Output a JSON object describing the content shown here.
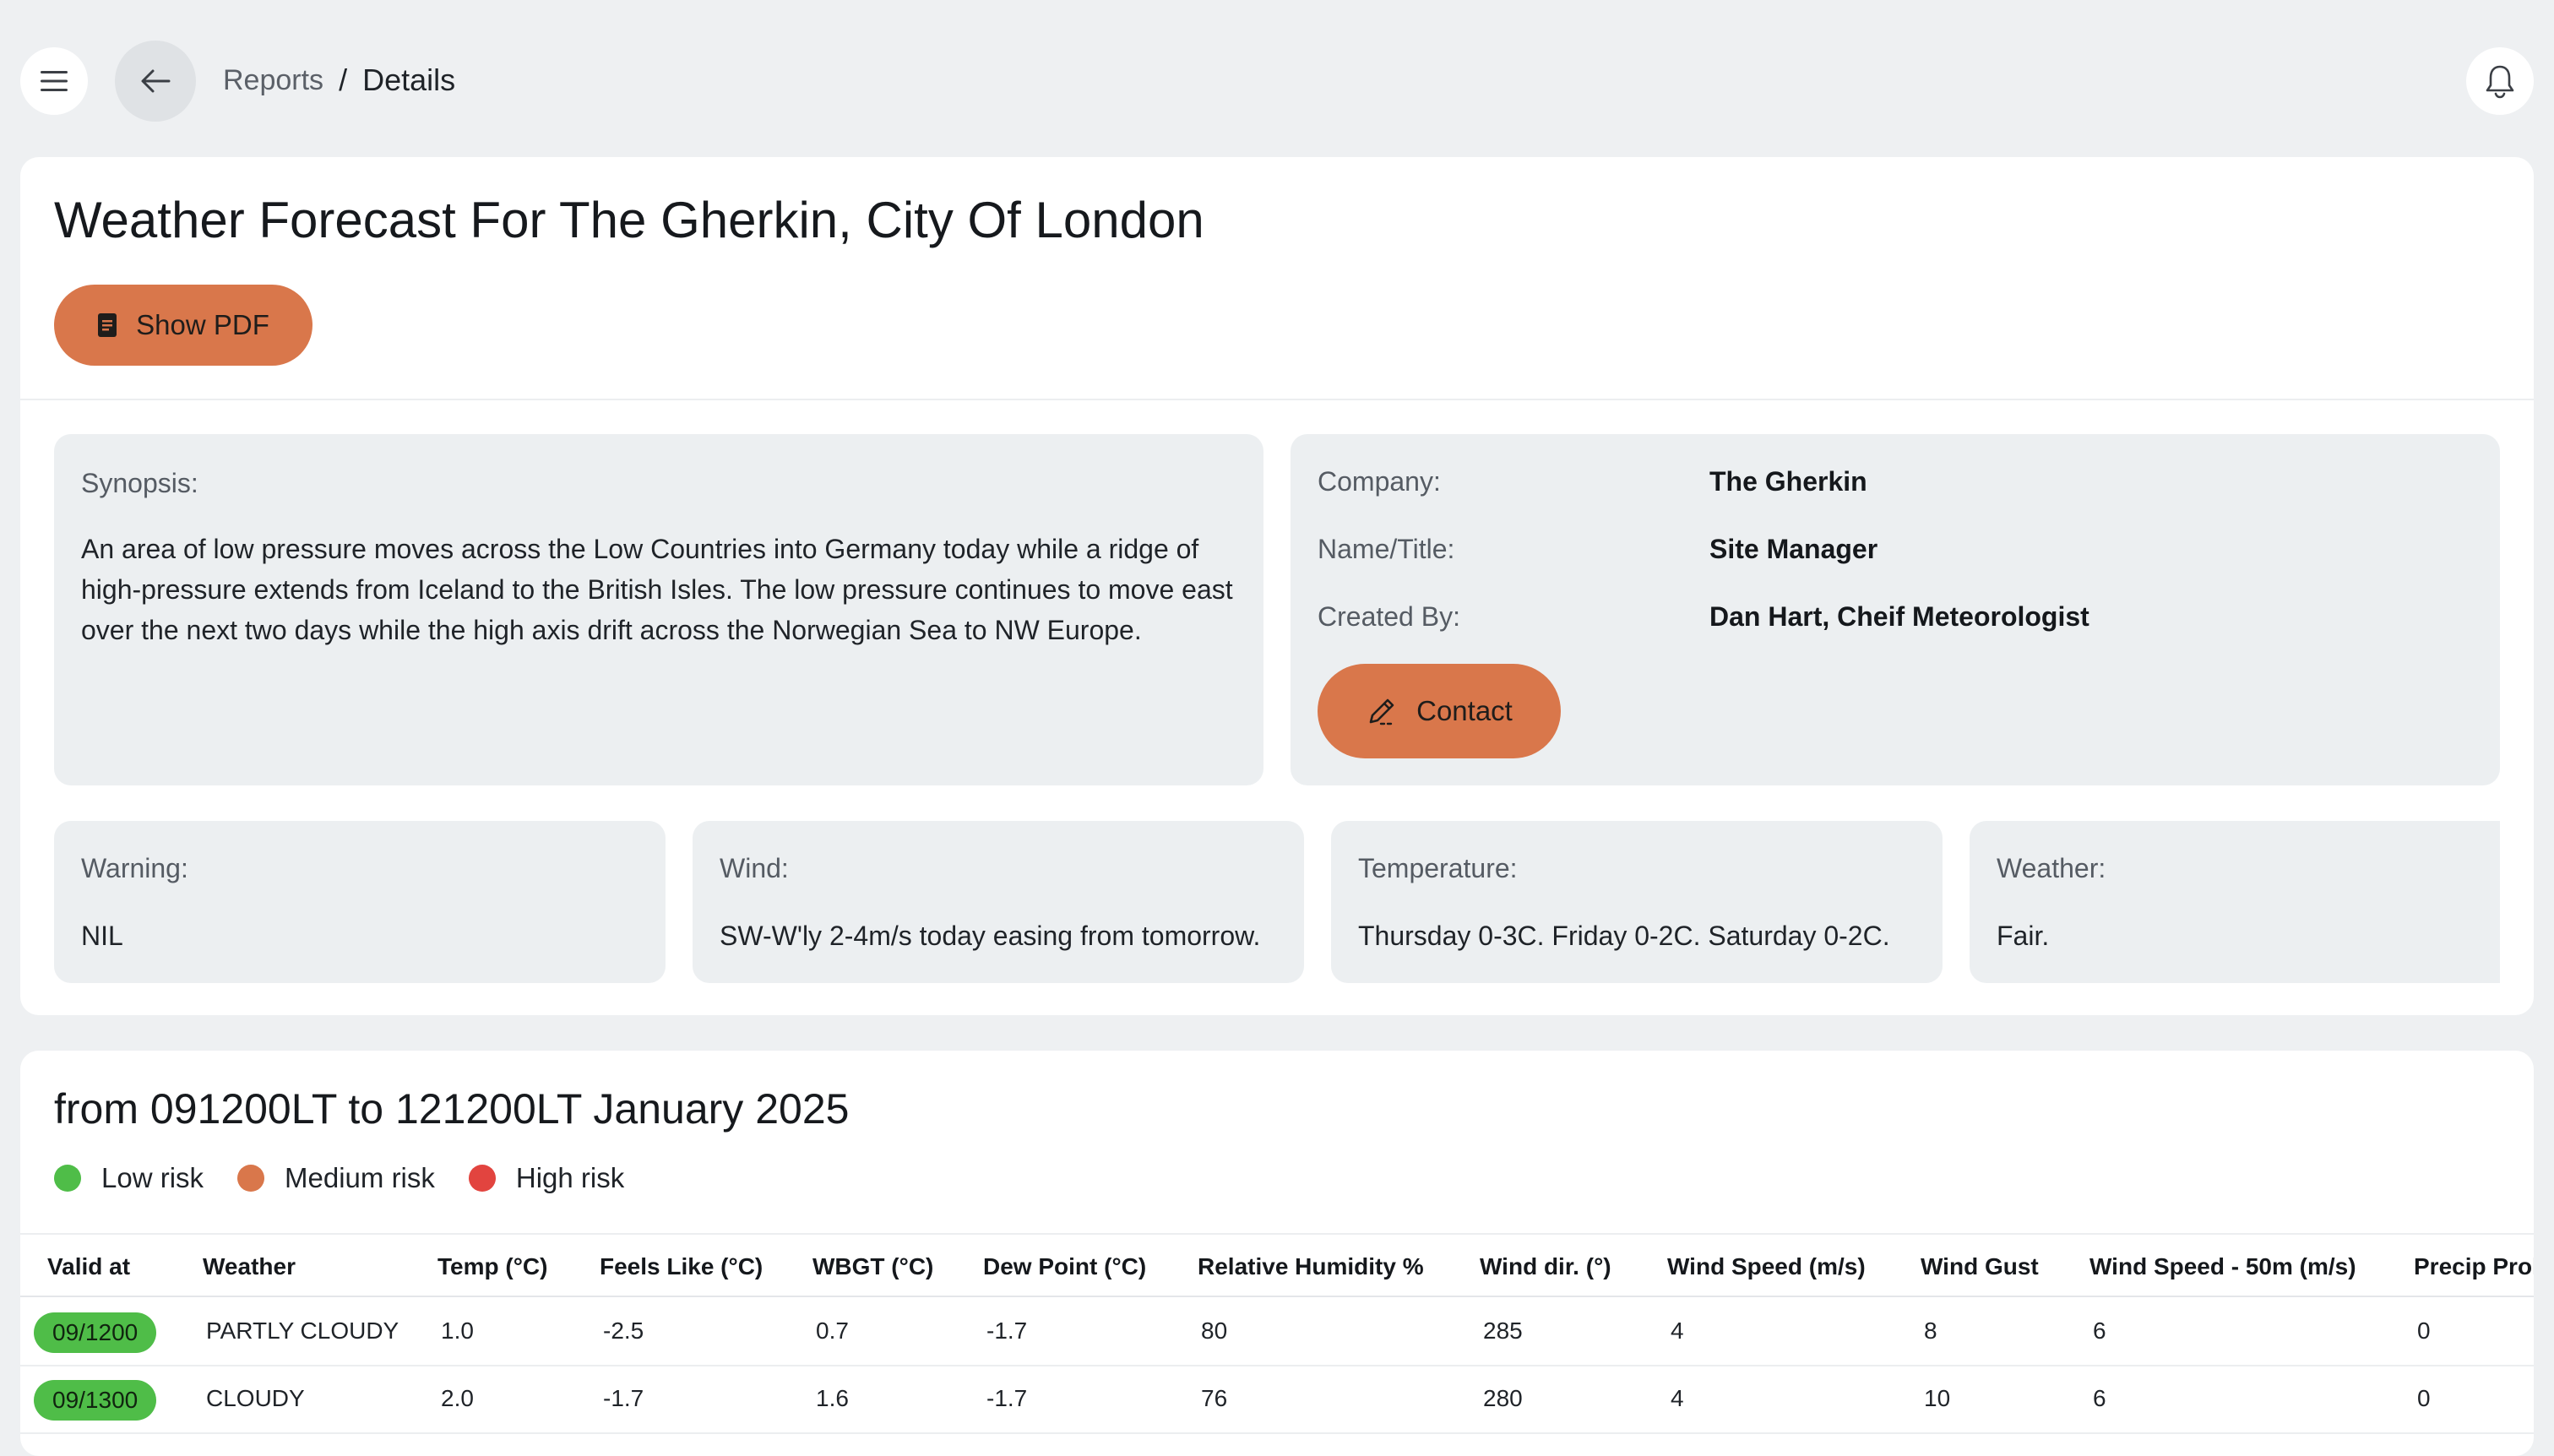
{
  "breadcrumb": {
    "parent": "Reports",
    "separator": "/",
    "current": "Details"
  },
  "page": {
    "title": "Weather Forecast For The Gherkin, City Of London",
    "show_pdf_label": "Show PDF"
  },
  "synopsis": {
    "label": "Synopsis:",
    "text": "An area of low pressure moves across the Low Countries into Germany today while a ridge of high-pressure extends from Iceland to the British Isles. The low pressure continues to move east over the next two days while the high axis drift across the Norwegian Sea to NW Europe."
  },
  "details": {
    "company_label": "Company:",
    "company_value": "The Gherkin",
    "name_label": "Name/Title:",
    "name_value": "Site Manager",
    "created_label": "Created By:",
    "created_value": "Dan Hart, Cheif Meteorologist",
    "contact_label": "Contact"
  },
  "summary": [
    {
      "title": "Warning:",
      "value": "NIL"
    },
    {
      "title": "Wind:",
      "value": "SW-W'ly 2-4m/s today easing from tomorrow."
    },
    {
      "title": "Temperature:",
      "value": "Thursday 0-3C. Friday 0-2C. Saturday 0-2C."
    },
    {
      "title": "Weather:",
      "value": "Fair."
    }
  ],
  "forecast": {
    "range_title": "from 091200LT to 121200LT January 2025",
    "legend": [
      {
        "label": "Low risk",
        "color": "#4fbd48"
      },
      {
        "label": "Medium risk",
        "color": "#d9774b"
      },
      {
        "label": "High risk",
        "color": "#e2443f"
      }
    ],
    "columns": [
      "Valid at",
      "Weather",
      "Temp (°C)",
      "Feels Like (°C)",
      "WBGT (°C)",
      "Dew Point (°C)",
      "Relative Humidity %",
      "Wind dir. (°)",
      "Wind Speed (m/s)",
      "Wind Gust",
      "Wind Speed - 50m (m/s)",
      "Precip Prol"
    ],
    "rows": [
      [
        "09/1200",
        "PARTLY CLOUDY",
        "1.0",
        "-2.5",
        "0.7",
        "-1.7",
        "80",
        "285",
        "4",
        "8",
        "6",
        "0"
      ],
      [
        "09/1300",
        "CLOUDY",
        "2.0",
        "-1.7",
        "1.6",
        "-1.7",
        "76",
        "280",
        "4",
        "10",
        "6",
        "0"
      ]
    ]
  },
  "colors": {
    "accent": "#d9774b",
    "low_risk": "#4fbd48",
    "background": "#eef0f2"
  },
  "icons": {
    "menu": "menu-icon",
    "back": "arrow-left-icon",
    "bell": "bell-icon",
    "pdf": "document-icon",
    "contact": "pencil-icon"
  }
}
